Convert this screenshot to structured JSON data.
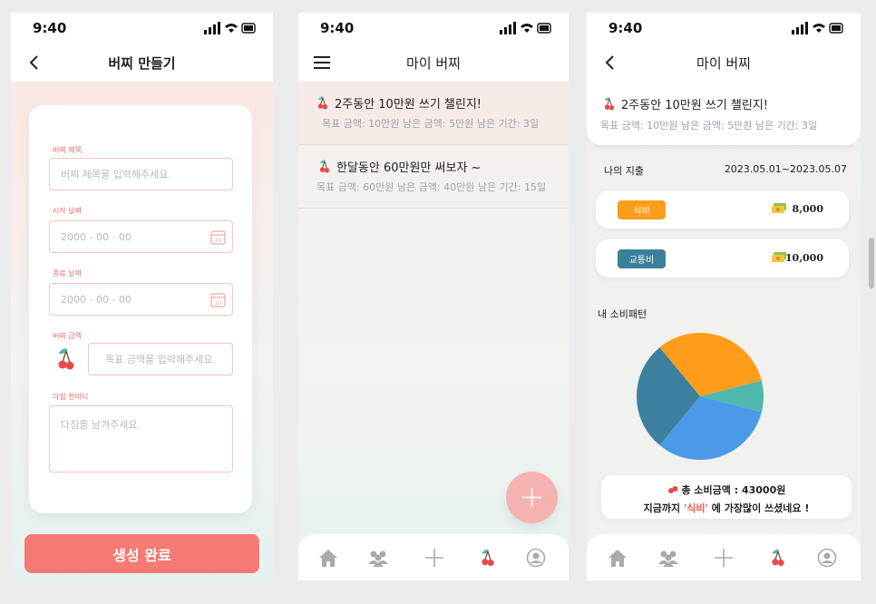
{
  "colors": {
    "accent": "#f47a73",
    "food_chip": "#ff9d1b",
    "transport_chip": "#3c7f99",
    "pie": [
      "#ff9d1b",
      "#4fb8ad",
      "#4a9ae8",
      "#3d7f9f"
    ]
  },
  "status": {
    "time": "9:40"
  },
  "screen1": {
    "header_title": "버찌 만들기",
    "labels": {
      "title": "버찌 제목",
      "start": "시작 날짜",
      "end": "종료 날짜",
      "amount": "버찌 금액",
      "memo": "다짐 한마디"
    },
    "placeholders": {
      "title": "버찌 제목을 입력해주세요.",
      "start": "2000 - 00 - 00",
      "end": "2000 - 00 - 00",
      "amount": "목표 금액을 입력해주세요.",
      "memo": "다짐을 남겨주세요."
    },
    "submit_label": "생성 완료"
  },
  "screen2": {
    "header_title": "마이 버찌",
    "items": [
      {
        "title": "2주동안 10만원 쓰기 챌린지!",
        "detail": "목표 금액: 10만원  남은 금액: 5만원 남은 기간: 3일"
      },
      {
        "title": "한달동안 60만원만 써보자 ~",
        "detail": "목표 금액: 60만원 남은 금액: 40만원 남은 기간: 15일"
      }
    ]
  },
  "screen3": {
    "header_title": "마이 버찌",
    "card": {
      "title": "2주동안 10만원 쓰기 챌린지!",
      "detail": "목표 금액: 10만원  남은 금액: 5만원 남은 기간: 3일"
    },
    "spending_label": "나의 지출",
    "period": "2023.05.01~2023.05.07",
    "expenses": [
      {
        "category": "식비",
        "amount": "8,000"
      },
      {
        "category": "교통비",
        "amount": "10,000"
      }
    ],
    "pattern_label": "내 소비패턴",
    "pie_shares": [
      0.32,
      0.08,
      0.32,
      0.28
    ],
    "summary_total": "총 소비금액 : 43000원",
    "summary_pre": "지금까지 ",
    "summary_highlight": "'식비'",
    "summary_post": " 에 가장많이 쓰셨네요 !"
  }
}
